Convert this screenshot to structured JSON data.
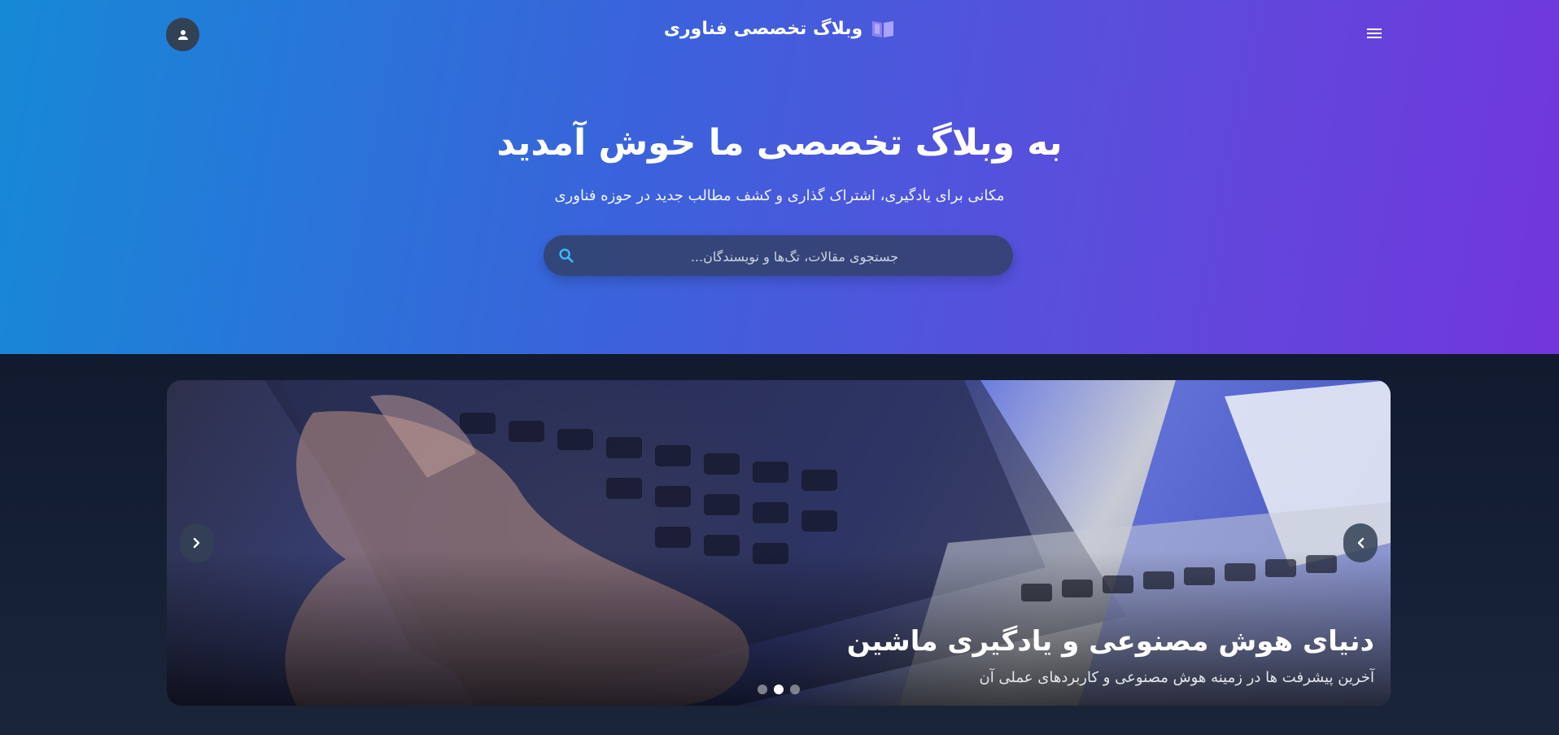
{
  "header": {
    "brand_title": "وبلاگ تخصصی فناوری",
    "brand_icon": "book-open-icon",
    "user_icon": "user-icon",
    "menu_icon": "menu-icon"
  },
  "hero": {
    "title": "به وبلاگ تخصصی ما خوش آمدید",
    "subtitle": "مکانی برای یادگیری، اشتراک گذاری و کشف مطالب جدید در حوزه فناوری",
    "search": {
      "placeholder": "جستجوی مقالات، تگ‌ها و نویسندگان...",
      "icon": "search-icon"
    }
  },
  "slider": {
    "slides": [
      {
        "title": "دنیای هوش مصنوعی و یادگیری ماشین",
        "description": "آخرین پیشرفت ها در زمینه هوش مصنوعی و کاربردهای عملی آن"
      }
    ],
    "active_index": 1,
    "dot_count": 3
  },
  "colors": {
    "accent": "#38bdf8",
    "hero_gradient_start": "#1689d6",
    "hero_gradient_end": "#7236dc",
    "background": "#0f172a"
  }
}
